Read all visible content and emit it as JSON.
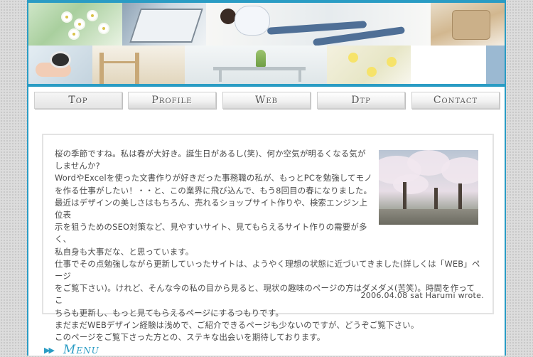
{
  "nav": {
    "items": [
      {
        "label": "Top",
        "active": true
      },
      {
        "label": "Profile",
        "active": false
      },
      {
        "label": "Web",
        "active": false
      },
      {
        "label": "Dtp",
        "active": false
      },
      {
        "label": "Contact",
        "active": false
      }
    ]
  },
  "intro": {
    "lines": [
      "桜の季節ですね。私は春が大好き。誕生日があるし(笑)、何か空気が明るくなる気が",
      "しませんか?",
      "WordやExcelを使った文書作りが好きだった事務職の私が、もっとPCを勉強してモノ",
      "を作る仕事がしたい！・・と、この業界に飛び込んで、もう8回目の春になりました。",
      "最近はデザインの美しさはもちろん、売れるショップサイト作りや、検索エンジン上位表",
      "示を狙うためのSEO対策など、見やすいサイト、見てもらえるサイト作りの需要が多く、",
      "私自身も大事だな、と思っています。",
      "仕事でその点勉強しながら更新していったサイトは、ようやく理想の状態に近づいてきました(詳しくは「WEB」ページ",
      "をご覧下さい)。けれど、そんな今の私の目から見ると、現状の趣味のページの方はダメダメ(苦笑)。時間を作ってこ",
      "ちらも更新し、もっと見てもらえるページにするつもりです。",
      "まだまだWEBデザイン経験は浅めで、ご紹介できるページも少ないのですが、どうぞご覧下さい。",
      "このページをご覧下さった方との、ステキな出会いを期待しております。"
    ],
    "signature": "2006.04.08 sat Harumi wrote."
  },
  "menu": {
    "arrow": "▶▶",
    "label": "Menu"
  },
  "colors": {
    "accent": "#2a9cc4",
    "text": "#4a4a4a",
    "nav_text": "#555555"
  }
}
